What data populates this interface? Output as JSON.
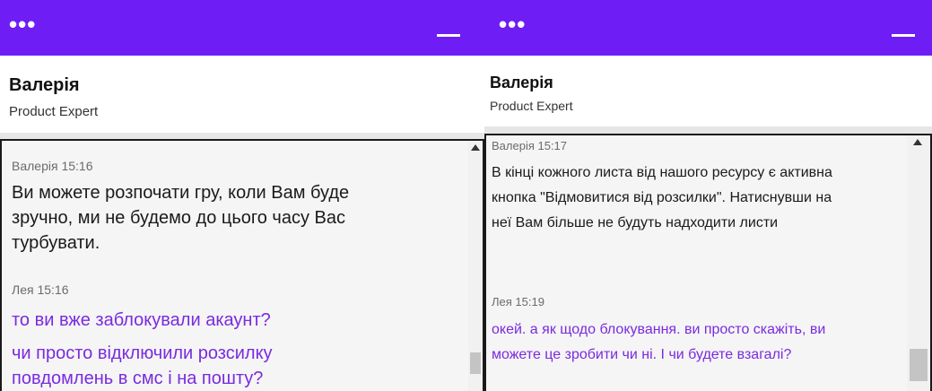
{
  "left": {
    "menu_icon": "•••",
    "agent_name": "Валерія",
    "agent_role": "Product Expert",
    "messages": [
      {
        "meta": "Валерія 15:16",
        "text": "Ви можете розпочати гру, коли Вам буде зручно, ми не будемо до цього часу Вас турбувати."
      },
      {
        "meta": "Лея 15:16",
        "text": "то ви вже заблокували акаунт?"
      },
      {
        "text": "чи просто відключили розсилку повдомлень в смс і на пошту?"
      }
    ]
  },
  "right": {
    "menu_icon": "•••",
    "agent_name": "Валерія",
    "agent_role": "Product Expert",
    "messages": [
      {
        "meta": "Валерія 15:17",
        "text": "В кінці кожного листа від нашого ресурсу є активна кнопка \"Відмовитися від розсилки\". Натиснувши на неї Вам більше не будуть надходити листи"
      },
      {
        "meta": "Лея 15:19",
        "text": "окей. а як щодо блокування. ви просто скажіть, ви можете це зробити чи ні. І чи будете взагалі?"
      }
    ]
  },
  "colors": {
    "header": "#6e1ef5",
    "user_text": "#7a2be0",
    "agent_text": "#1a1a1a",
    "meta_text": "#6b6b6b"
  },
  "icons": [
    "more-icon",
    "minimize-icon",
    "scroll-up-icon"
  ]
}
